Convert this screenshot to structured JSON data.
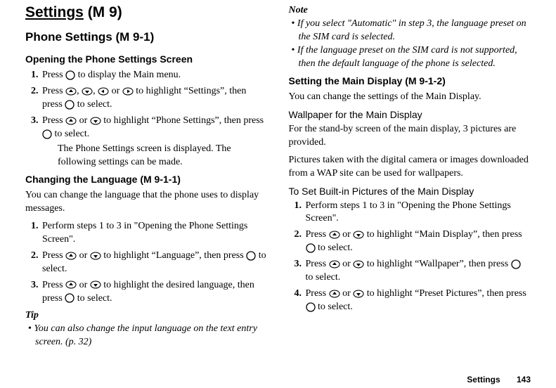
{
  "left": {
    "title_main": "Settings",
    "title_code": "(M 9)",
    "h2_text": "Phone Settings",
    "h2_code": "(M 9-1)",
    "h3_open": "Opening the Phone Settings Screen",
    "open_steps": {
      "s1": "Press    to display the Main menu.",
      "s2a": "Press   ,   ,    or    to highlight \"Settings\", then press    to select.",
      "s3a": "Press    or    to highlight \"Phone Settings\", then press    to select.",
      "s3b": "The Phone Settings screen is displayed. The following settings can be made."
    },
    "h3_lang": "Changing the Language",
    "h3_lang_code": "(M 9-1-1)",
    "lang_intro": "You can change the language that the phone uses to display messages.",
    "lang_steps": {
      "s1": "Perform steps 1 to 3 in \"Opening the Phone Settings Screen\".",
      "s2": "Press    or    to highlight \"Language\", then press    to select.",
      "s3": "Press    or    to highlight the desired language, then press    to select."
    },
    "tip_head": "Tip",
    "tip_item": "You can also change the input language on the text entry screen. (p. 32)"
  },
  "right": {
    "note_head": "Note",
    "note_items": {
      "n1": "If you select \"Automatic\" in step 3, the language preset on the SIM card is selected.",
      "n2": "If the language preset on the SIM card is not supported, then the default language of the phone is selected."
    },
    "h3_main": "Setting the Main Display",
    "h3_main_code": "(M 9-1-2)",
    "main_intro": "You can change the settings of the Main Display.",
    "h4_wall": "Wallpaper for the Main Display",
    "wall_p1": "For the stand-by screen of the main display, 3 pictures are provided.",
    "wall_p2": "Pictures taken with the digital camera or images downloaded from a WAP site can be used for wallpapers.",
    "h4_builtin": "To Set Built-in Pictures of the Main Display",
    "builtin_steps": {
      "s1": "Perform steps 1 to 3 in \"Opening the Phone Settings Screen\".",
      "s2": "Press    or    to highlight \"Main Display\", then press    to select.",
      "s3": "Press    or    to highlight \"Wallpaper\", then press    to select.",
      "s4": "Press    or    to highlight \"Preset Pictures\", then press    to select."
    }
  },
  "footer": {
    "label": "Settings",
    "page": "143"
  }
}
